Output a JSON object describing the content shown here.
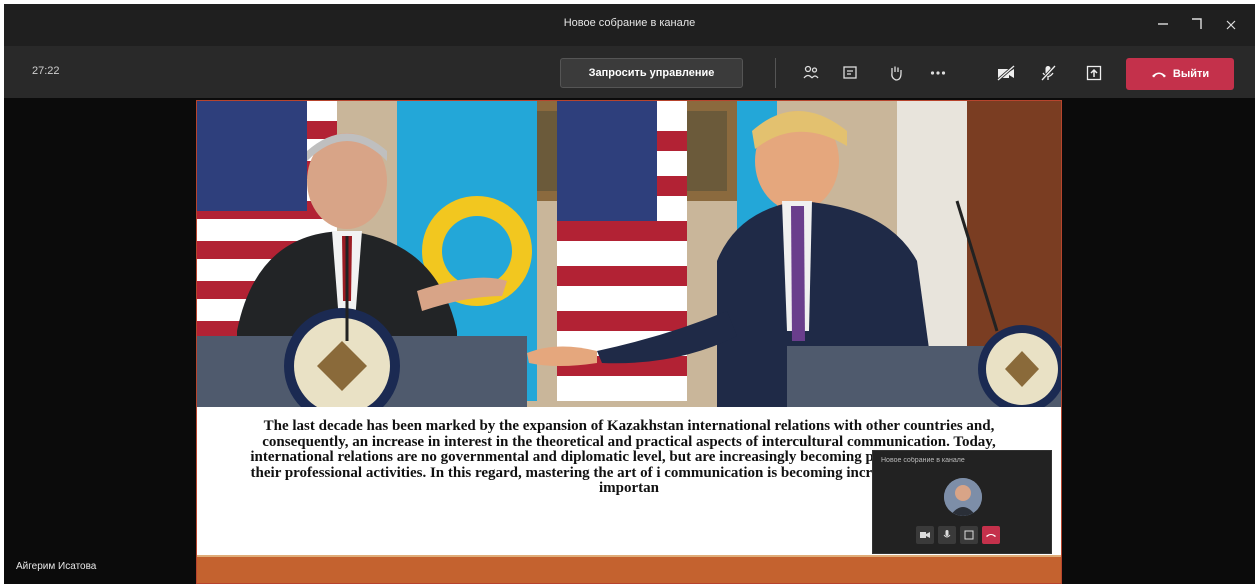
{
  "window": {
    "title": "Новое собрание в канале",
    "controls": [
      "minimize-icon",
      "maximize-icon",
      "close-icon"
    ]
  },
  "toolbar": {
    "timer": "27:22",
    "request_control_label": "Запросить управление",
    "icons": [
      "participants-icon",
      "chat-icon",
      "raise-hand-icon",
      "more-icon",
      "camera-off-icon",
      "mic-off-icon",
      "share-icon"
    ],
    "leave_label": "Выйти"
  },
  "slide": {
    "text": "The last decade has been marked by the expansion of Kazakhstan international relations with other countries and, consequently, an increase in interest in the theoretical and practical aspects of intercultural communication. Today, international relations are no governmental and diplomatic level, but are increasingly becoming part of peop including their professional activities. In this regard, mastering the art of i communication is becoming increasingly relevant and importan"
  },
  "pip": {
    "title": "Новое собрание в канале"
  },
  "participant": {
    "name": "Айгерим Исатова"
  },
  "colors": {
    "leave": "#c4314b",
    "slide_border": "#b7442d",
    "slide_bar": "#c4622f"
  }
}
